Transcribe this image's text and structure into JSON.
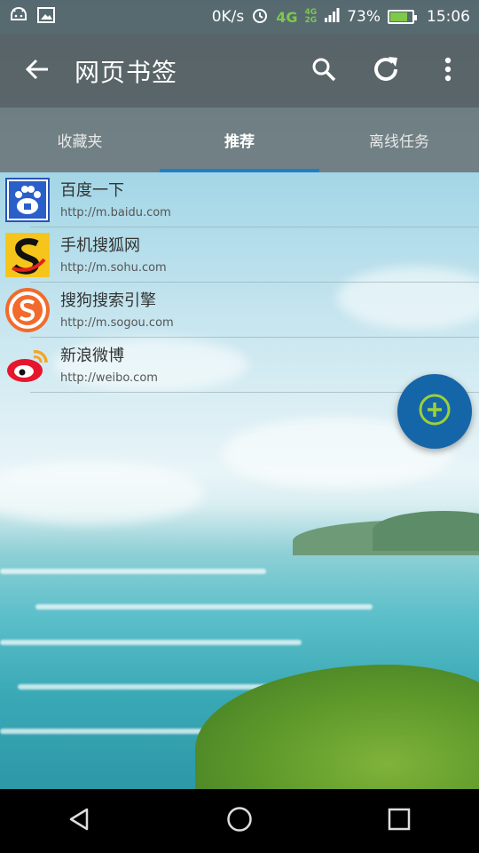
{
  "status_bar": {
    "speed": "0K/s",
    "network": "4G",
    "mini_network_top": "4G",
    "mini_network_bottom": "2G",
    "battery_percent": "73%",
    "battery_level": 0.73,
    "time": "15:06",
    "icons": [
      "android-icon",
      "image-icon",
      "alarm-icon",
      "signal-icon",
      "battery-charging-icon"
    ]
  },
  "toolbar": {
    "title": "网页书签",
    "back_icon": "arrow-left-icon",
    "actions": [
      "search-icon",
      "refresh-icon",
      "more-vert-icon"
    ]
  },
  "tabs": [
    {
      "label": "收藏夹",
      "active": false
    },
    {
      "label": "推荐",
      "active": true
    },
    {
      "label": "离线任务",
      "active": false
    }
  ],
  "bookmarks": [
    {
      "name": "百度一下",
      "url": "http://m.baidu.com",
      "icon": "baidu-logo-icon"
    },
    {
      "name": "手机搜狐网",
      "url": "http://m.sohu.com",
      "icon": "sohu-logo-icon"
    },
    {
      "name": "搜狗搜索引擎",
      "url": "http://m.sogou.com",
      "icon": "sogou-logo-icon"
    },
    {
      "name": "新浪微博",
      "url": "http://weibo.com",
      "icon": "weibo-logo-icon"
    }
  ],
  "fab": {
    "icon": "add-circle-icon"
  },
  "navbar": [
    "back-triangle-icon",
    "home-circle-icon",
    "recents-square-icon"
  ],
  "colors": {
    "accent": "#1e7fc6",
    "fab": "#1566a8",
    "fab_icon": "#9bd13a"
  }
}
